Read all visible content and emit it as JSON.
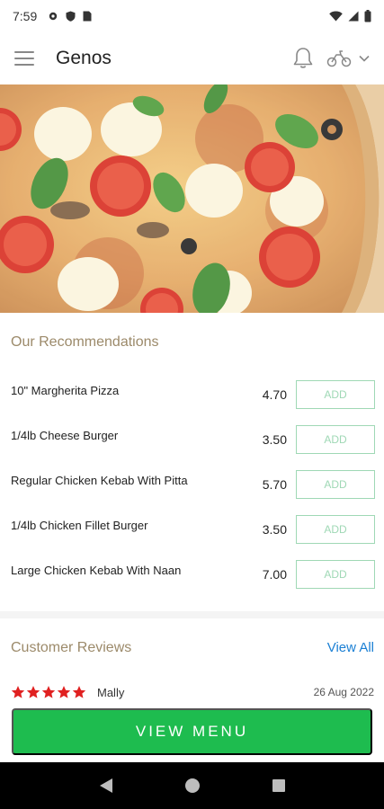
{
  "status_bar": {
    "time": "7:59"
  },
  "app_bar": {
    "title": "Genos"
  },
  "recommendations": {
    "title": "Our Recommendations",
    "items": [
      {
        "name": "10\" Margherita Pizza",
        "price": "4.70",
        "action": "ADD"
      },
      {
        "name": "1/4lb Cheese Burger",
        "price": "3.50",
        "action": "ADD"
      },
      {
        "name": "Regular Chicken Kebab With Pitta",
        "price": "5.70",
        "action": "ADD"
      },
      {
        "name": "1/4lb Chicken Fillet Burger",
        "price": "3.50",
        "action": "ADD"
      },
      {
        "name": "Large Chicken Kebab With Naan",
        "price": "7.00",
        "action": "ADD"
      }
    ]
  },
  "reviews": {
    "title": "Customer Reviews",
    "view_all": "View All",
    "first": {
      "rating": 5,
      "name": "Mally",
      "date": "26 Aug 2022"
    }
  },
  "footer": {
    "view_menu": "VIEW MENU"
  },
  "colors": {
    "accent_green": "#1ebc4f",
    "link_blue": "#1a7fd4",
    "star_red": "#e02020",
    "section_title": "#9c8a6a"
  },
  "icons": [
    "gear-icon",
    "shield-icon",
    "sim-icon",
    "wifi-icon",
    "signal-icon",
    "battery-icon",
    "menu-icon",
    "bell-icon",
    "scooter-icon",
    "chevron-down-icon",
    "star-icon",
    "back-icon",
    "home-icon",
    "recents-icon"
  ]
}
